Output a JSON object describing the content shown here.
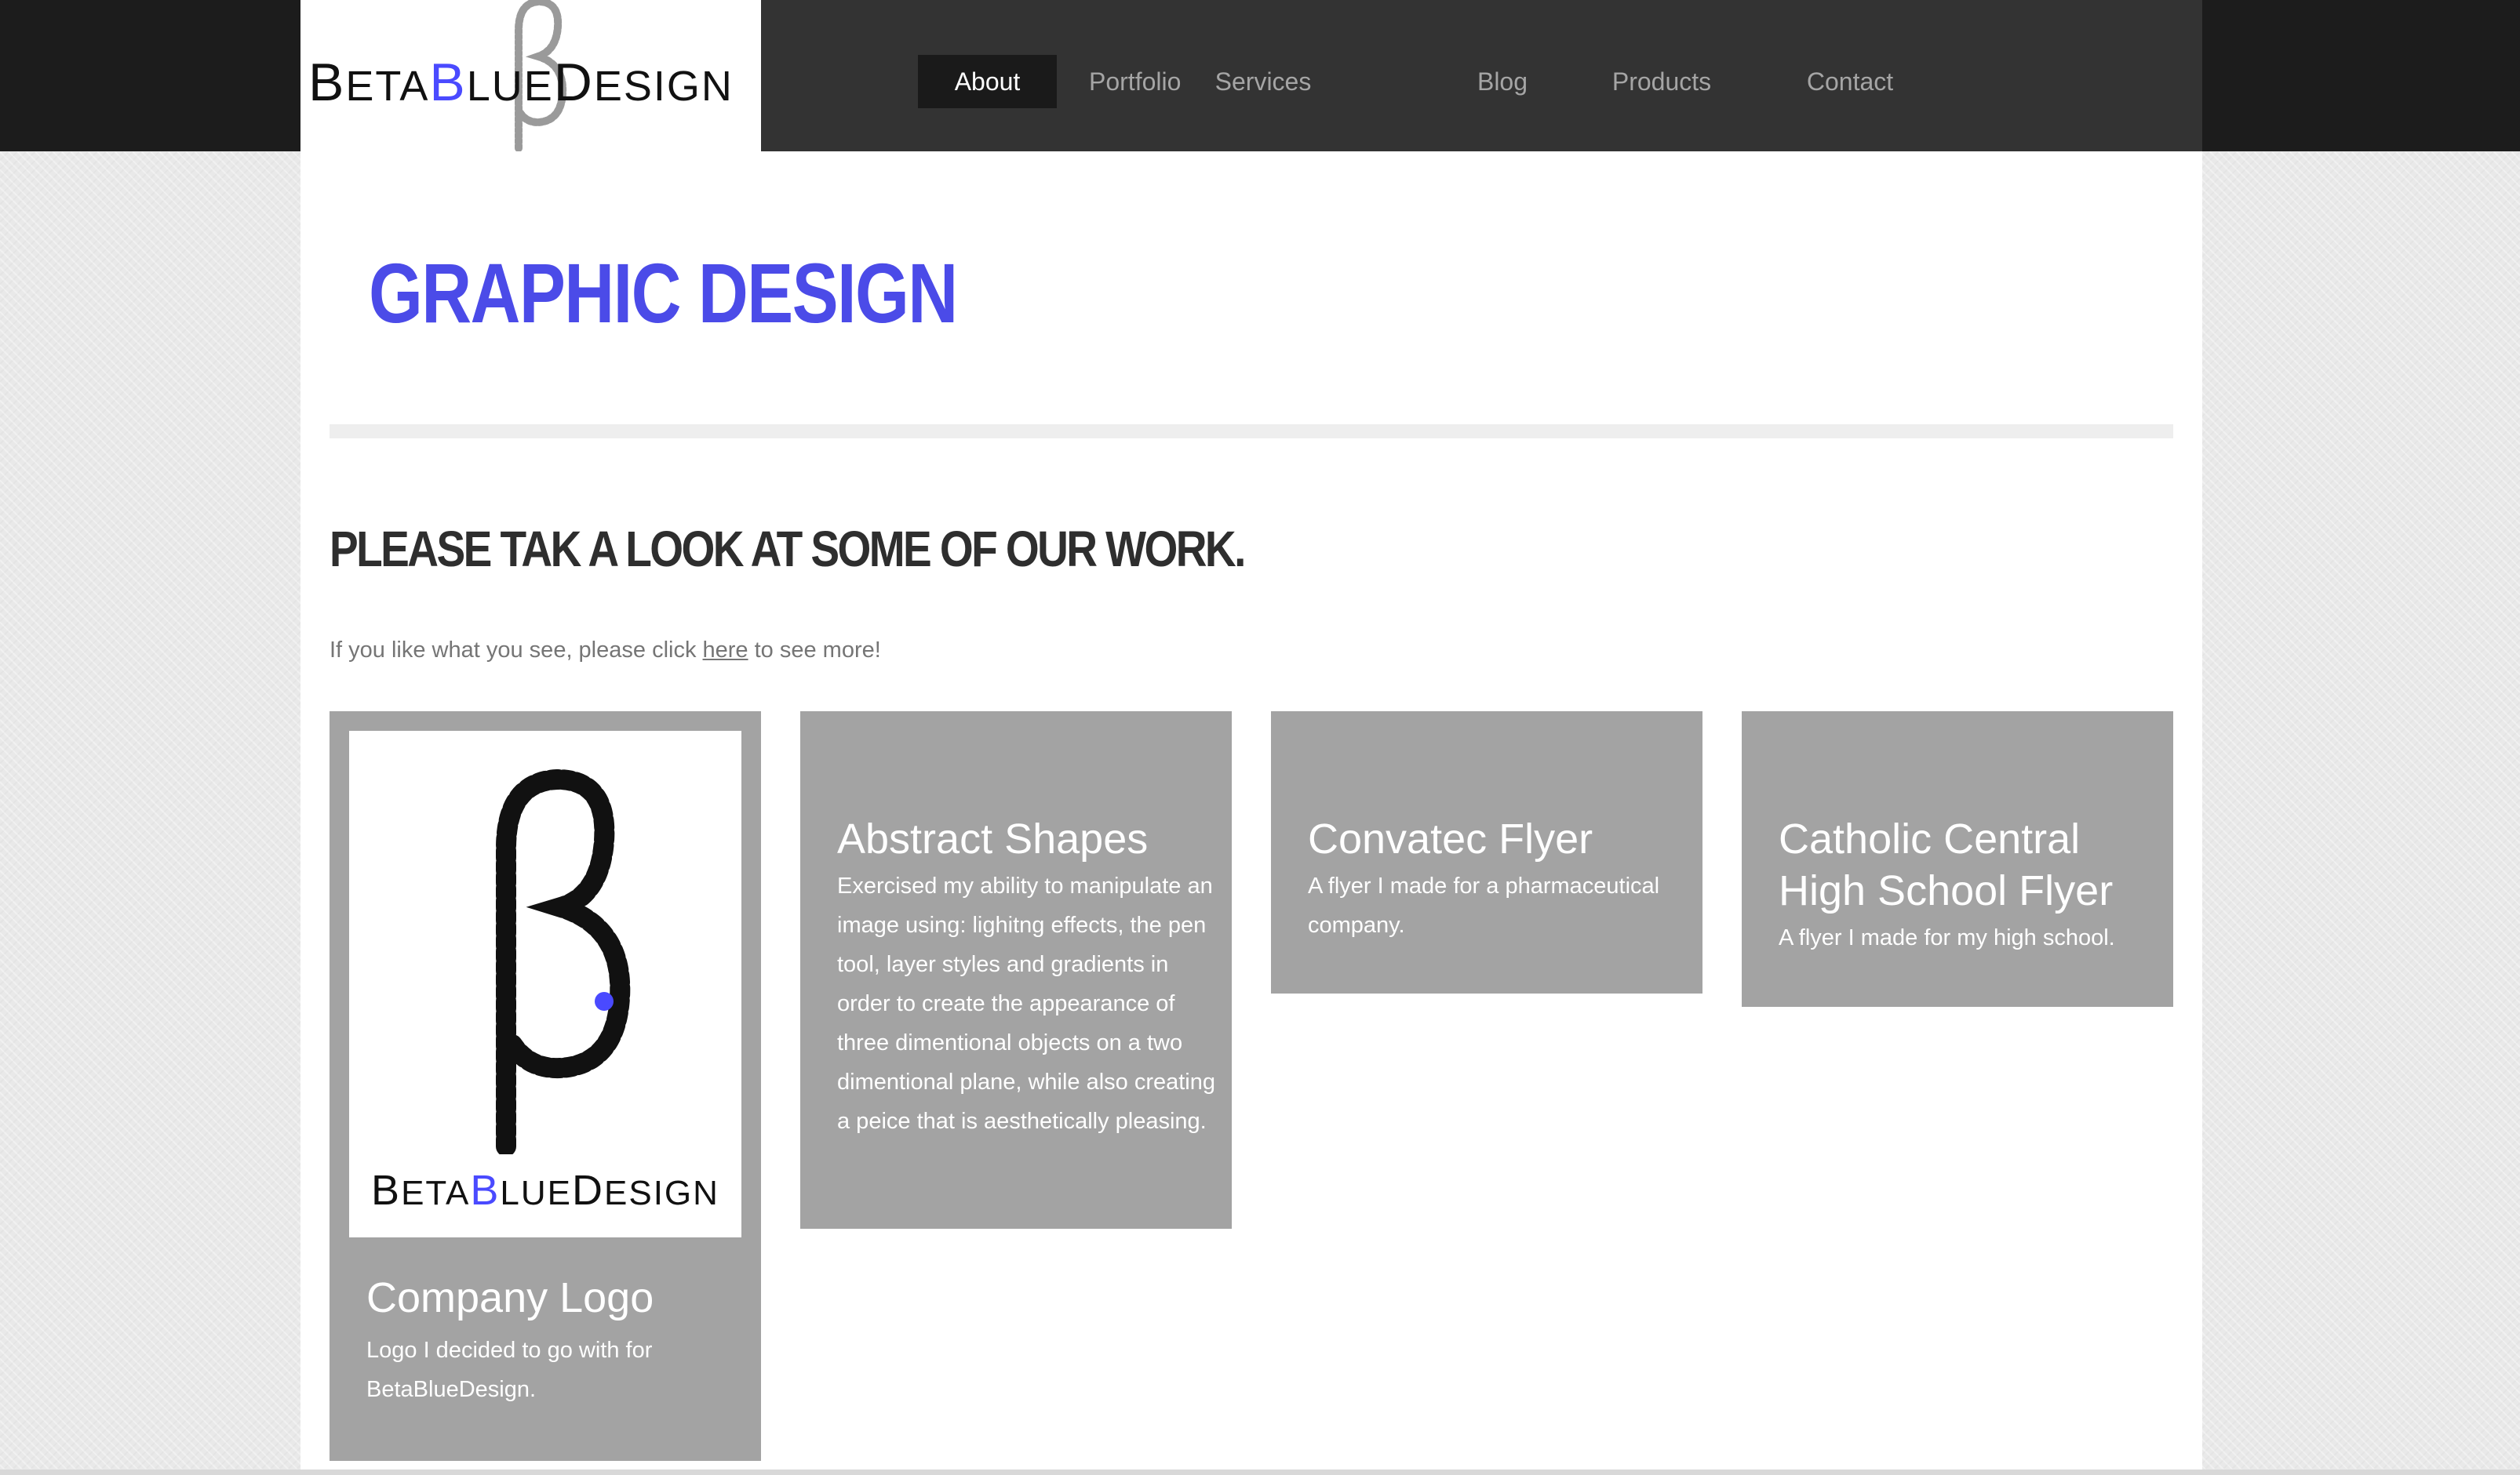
{
  "brand": {
    "logo": {
      "part1": "Beta",
      "part2": "Blue",
      "part3": "Design",
      "accent_color": "#4a4aff"
    }
  },
  "nav": {
    "items": [
      {
        "label": "About",
        "active": true
      },
      {
        "label": "Portfolio",
        "active": false
      },
      {
        "label": "Services",
        "active": false
      },
      {
        "label": "Blog",
        "active": false
      },
      {
        "label": "Products",
        "active": false
      },
      {
        "label": "Contact",
        "active": false
      }
    ]
  },
  "page": {
    "title": "GRAPHIC DESIGN",
    "heading": "PLEASE TAK A LOOK AT SOME OF OUR WORK.",
    "intro": {
      "before": "If you like what you see, please click ",
      "link": "here",
      "after": " to see more!"
    }
  },
  "cards": [
    {
      "title": "Company Logo",
      "description": "Logo I decided to go with for BetaBlueDesign.",
      "thumbnail": "betabluedesign-logo"
    },
    {
      "title": "Abstract Shapes",
      "description": "Exercised my ability to manipulate an image using: lighitng effects, the pen tool, layer styles and gradients in order to create the appearance of three dimentional objects on a two dimentional plane, while also creating a peice that is aesthetically pleasing."
    },
    {
      "title": "Convatec Flyer",
      "description": "A flyer I made for a pharmaceutical company."
    },
    {
      "title": "Catholic Central High School Flyer",
      "description": "A flyer I made for my high school."
    }
  ],
  "colors": {
    "title_blue": "#4b4be8",
    "header_bg": "#333333",
    "nav_active_bg": "#1a1a1a",
    "card_bg": "#a3a3a3"
  }
}
